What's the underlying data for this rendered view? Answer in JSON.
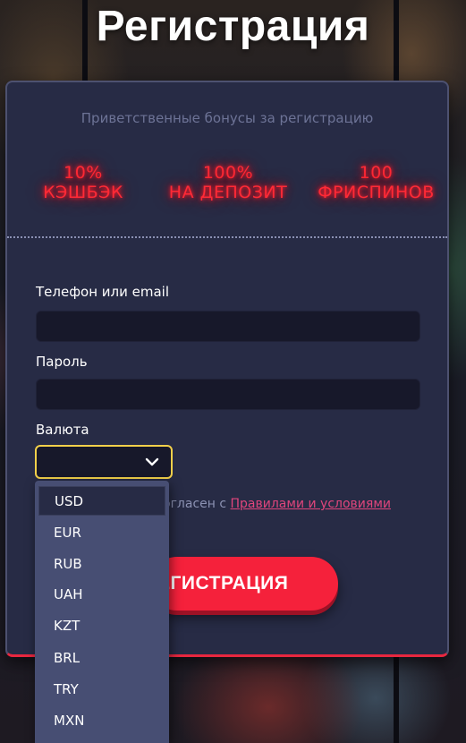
{
  "page": {
    "title": "Регистрация"
  },
  "bonuses": {
    "heading": "Приветственные бонусы за регистрацию",
    "items": [
      {
        "line1": "10%",
        "line2": "КЭШБЭК"
      },
      {
        "line1": "100%",
        "line2": "НА ДЕПОЗИТ"
      },
      {
        "line1": "100",
        "line2": "ФРИСПИНОВ"
      }
    ]
  },
  "form": {
    "login_label": "Телефон или email",
    "login_value": "",
    "password_label": "Пароль",
    "password_value": "",
    "currency_label": "Валюта",
    "currency_value": "",
    "terms_prefix": "огласен с ",
    "terms_link": "Правилами и условиями",
    "submit_label": "ЕГИСТРАЦИЯ"
  },
  "currency_dropdown": {
    "options": [
      "USD",
      "EUR",
      "RUB",
      "UAH",
      "KZT",
      "BRL",
      "TRY",
      "MXN"
    ],
    "highlighted": "USD"
  },
  "colors": {
    "accent": "#f5213b",
    "neon_text": "#ff2a36",
    "focus_border": "#f2d04a",
    "link": "#e0457c",
    "card_bg": "#272b45"
  },
  "icons": {
    "password_toggle": "eye-icon",
    "select_arrow": "chevron-down-icon"
  }
}
